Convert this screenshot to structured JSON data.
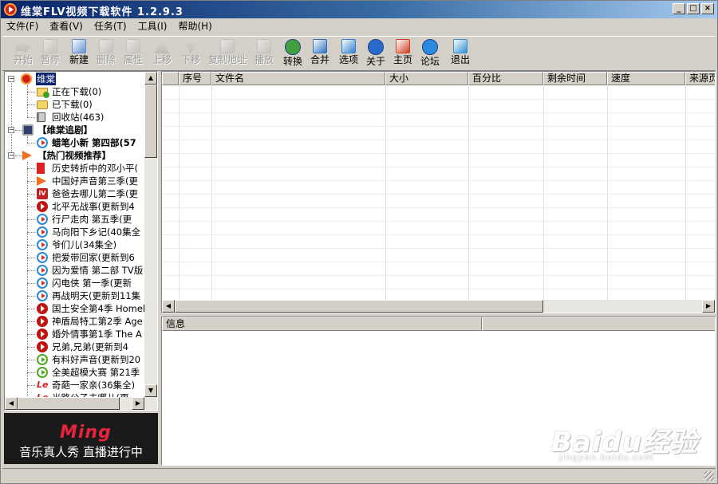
{
  "window": {
    "title": "维棠FLV视频下载软件 1.2.9.3",
    "caption_buttons": [
      "_",
      "□",
      "×"
    ]
  },
  "menu": [
    "文件(F)",
    "查看(V)",
    "任务(T)",
    "工具(I)",
    "帮助(H)"
  ],
  "toolbar": [
    {
      "label": "开始",
      "icon": "play-arrow-icon",
      "enabled": false
    },
    {
      "label": "暂停",
      "icon": "pause-icon",
      "enabled": false
    },
    {
      "label": "新建",
      "icon": "new-document-icon",
      "enabled": true
    },
    {
      "label": "删除",
      "icon": "delete-icon",
      "enabled": false
    },
    {
      "label": "属性",
      "icon": "properties-icon",
      "enabled": false
    },
    {
      "label": "上移",
      "icon": "move-up-icon",
      "enabled": false
    },
    {
      "label": "下移",
      "icon": "move-down-icon",
      "enabled": false
    },
    {
      "label": "复制地址",
      "icon": "copy-address-icon",
      "enabled": false
    },
    {
      "label": "播放",
      "icon": "play-icon",
      "enabled": false
    },
    {
      "label": "转换",
      "icon": "convert-icon",
      "enabled": true
    },
    {
      "label": "合并",
      "icon": "merge-icon",
      "enabled": true
    },
    {
      "label": "选项",
      "icon": "options-icon",
      "enabled": true
    },
    {
      "label": "关于",
      "icon": "help-icon",
      "enabled": true
    },
    {
      "label": "主页",
      "icon": "home-icon",
      "enabled": true
    },
    {
      "label": "论坛",
      "icon": "forum-icon",
      "enabled": true
    },
    {
      "label": "退出",
      "icon": "exit-icon",
      "enabled": true
    }
  ],
  "tree": {
    "root": "维棠",
    "downloading": "正在下载(0)",
    "downloaded": "已下载(0)",
    "recycle": "回收站(463)",
    "group_follow": "【维棠追剧】",
    "follow_item": "蜡笔小新 第四部(57",
    "group_hot": "【热门视频推荐】",
    "hot_items": [
      {
        "text": "历史转折中的邓小平(",
        "icon": "red-l"
      },
      {
        "text": "中国好声音第三季(更",
        "icon": "arrow"
      },
      {
        "text": "爸爸去哪儿第二季(更",
        "icon": "tv"
      },
      {
        "text": "北平无战事(更新到4",
        "icon": "redplay"
      },
      {
        "text": "行尸走肉 第五季(更",
        "icon": "play"
      },
      {
        "text": "马向阳下乡记(40集全",
        "icon": "play"
      },
      {
        "text": "爷们儿(34集全)",
        "icon": "play"
      },
      {
        "text": "把爱带回家(更新到6",
        "icon": "play"
      },
      {
        "text": "因为爱情 第二部 TV版",
        "icon": "play"
      },
      {
        "text": "闪电侠 第一季(更新",
        "icon": "play"
      },
      {
        "text": "再战明天(更新到11集",
        "icon": "play"
      },
      {
        "text": "国土安全第4季 Homel",
        "icon": "redplay"
      },
      {
        "text": "神盾局特工第2季 Age",
        "icon": "redplay"
      },
      {
        "text": "婚外情事第1季 The A",
        "icon": "redplay"
      },
      {
        "text": "兄弟,兄弟(更新到4",
        "icon": "redplay"
      },
      {
        "text": "有料好声音(更新到20",
        "icon": "greenplay"
      },
      {
        "text": "全美超模大赛 第21季",
        "icon": "greenplay"
      },
      {
        "text": "奇葩一家亲(36集全)",
        "icon": "le"
      },
      {
        "text": "光路公子去哪儿(更",
        "icon": "le"
      }
    ]
  },
  "ad": {
    "logo": "Ming",
    "text": "音乐真人秀 直播进行中"
  },
  "grid": {
    "columns": [
      "",
      "序号",
      "文件名",
      "大小",
      "百分比",
      "剩余时间",
      "速度",
      "来源页"
    ]
  },
  "info": {
    "columns": [
      "信息",
      ""
    ]
  },
  "watermark": {
    "text": "Baidu经验",
    "sub": "jingyan.baidu.com"
  }
}
